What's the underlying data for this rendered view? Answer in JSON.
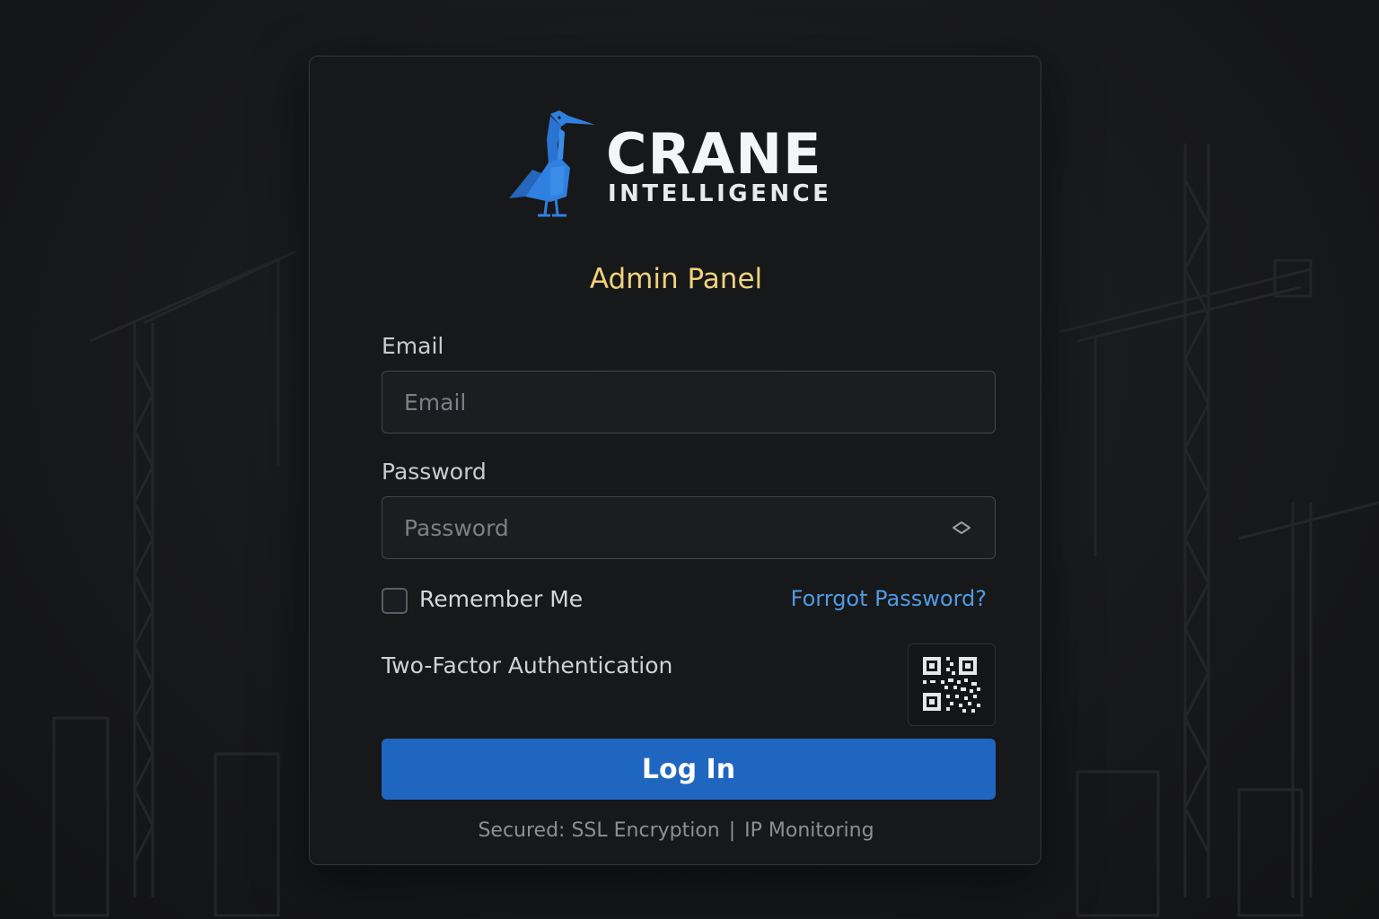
{
  "brand": {
    "name": "CRANE",
    "subtitle": "INTELLIGENCE",
    "logo_icon": "crane-bird-icon",
    "accent_color": "#2f80e0"
  },
  "panel_title": "Admin Panel",
  "form": {
    "email": {
      "label": "Email",
      "placeholder": "Email",
      "value": ""
    },
    "password": {
      "label": "Password",
      "placeholder": "Password",
      "value": "",
      "toggle_icon": "eye-toggle-icon"
    },
    "remember_me": {
      "label": "Remember Me",
      "checked": false
    },
    "forgot_password": "Forrgot Password?",
    "two_factor": {
      "label": "Two-Factor Authentication",
      "icon": "qr-code-icon"
    },
    "submit_label": "Log In"
  },
  "footer": {
    "security": "Secured: SSL Encryption",
    "monitoring": "IP Monitoring"
  },
  "colors": {
    "title": "#f1d27a",
    "link": "#4f9ae8",
    "button": "#1f66c1"
  }
}
